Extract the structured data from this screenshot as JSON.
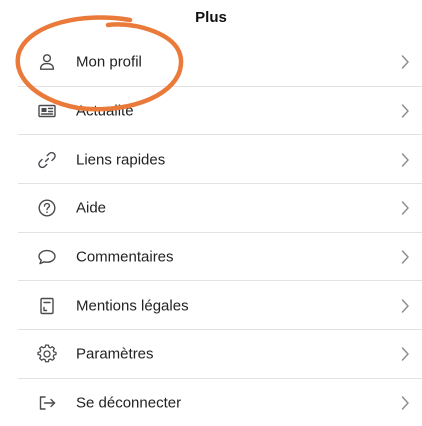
{
  "header": {
    "title": "Plus"
  },
  "menu": {
    "items": [
      {
        "label": "Mon profil",
        "icon": "person-icon"
      },
      {
        "label": "Actualité",
        "icon": "newspaper-icon"
      },
      {
        "label": "Liens rapides",
        "icon": "link-icon"
      },
      {
        "label": "Aide",
        "icon": "help-icon"
      },
      {
        "label": "Commentaires",
        "icon": "speech-bubble-icon"
      },
      {
        "label": "Mentions légales",
        "icon": "document-icon"
      },
      {
        "label": "Paramètres",
        "icon": "gear-icon"
      },
      {
        "label": "Se déconnecter",
        "icon": "logout-icon"
      }
    ]
  },
  "colors": {
    "icon": "#4a4a4f",
    "chevron": "#8e8e93",
    "divider": "#e3e3e6",
    "annotation": "#ea7a3a"
  }
}
